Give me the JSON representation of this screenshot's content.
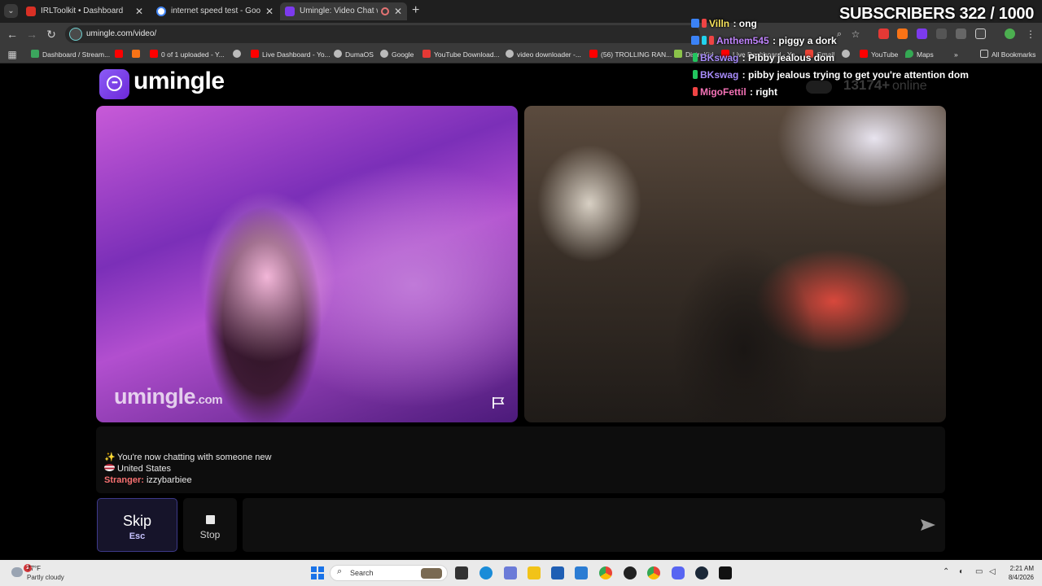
{
  "browser": {
    "tabs": [
      {
        "label": "IRLToolkit • Dashboard",
        "icon": "irltoolkit-icon",
        "color": "#d93025",
        "active": false
      },
      {
        "label": "internet speed test - Google Se",
        "icon": "google-icon",
        "color": "#4285f4",
        "active": false
      },
      {
        "label": "Umingle: Video Chat with S",
        "icon": "umingle-icon",
        "color": "#7c3aed",
        "active": true
      }
    ],
    "address": "umingle.com/video/",
    "bookmarks": [
      {
        "label": "Dashboard / Stream...",
        "icon": "streamelements-icon",
        "color": "#3ba55d"
      },
      {
        "label": "",
        "icon": "youtube-icon",
        "color": "#ff0000"
      },
      {
        "label": "",
        "icon": "folder-icon",
        "color": "#f97316"
      },
      {
        "label": "0 of 1 uploaded - Y...",
        "icon": "youtube-icon",
        "color": "#ff0000"
      },
      {
        "label": "",
        "icon": "globe-icon",
        "color": "#bbbbbb"
      },
      {
        "label": "Live Dashboard - Yo...",
        "icon": "youtube-icon",
        "color": "#ff0000"
      },
      {
        "label": "DumaOS",
        "icon": "globe-icon",
        "color": "#bbbbbb"
      },
      {
        "label": "Google",
        "icon": "google-icon",
        "color": "#bbbbbb"
      },
      {
        "label": "YouTube Download...",
        "icon": "download-icon",
        "color": "#e53935"
      },
      {
        "label": "video downloader -...",
        "icon": "google-icon",
        "color": "#bbbbbb"
      },
      {
        "label": "(56) TROLLING RAN...",
        "icon": "youtube-icon",
        "color": "#ff0000"
      },
      {
        "label": "DistroKid",
        "icon": "distrokid-icon",
        "color": "#8bc34a"
      },
      {
        "label": "Live Dashboard - Yo...",
        "icon": "youtube-icon",
        "color": "#ff0000"
      },
      {
        "label": "Gmail",
        "icon": "gmail-icon",
        "color": "#ea4335"
      },
      {
        "label": "",
        "icon": "globe-icon",
        "color": "#bbbbbb"
      },
      {
        "label": "YouTube",
        "icon": "youtube-icon",
        "color": "#ff0000"
      },
      {
        "label": "Maps",
        "icon": "maps-icon",
        "color": "#34a853"
      }
    ],
    "all_bookmarks": "All Bookmarks"
  },
  "site": {
    "logo_text": "umingle",
    "online_count": "13174+",
    "online_label": "online",
    "watermark_main": "umingle",
    "watermark_suffix": ".com",
    "chat": {
      "line1": "You're now chatting with someone new",
      "line2": "United States",
      "stranger_label": "Stranger:",
      "stranger_name": "izzybarbiee"
    },
    "skip_label": "Skip",
    "skip_key": "Esc",
    "stop_label": "Stop",
    "input_placeholder": ""
  },
  "overlay": {
    "subscribers": "SUBSCRIBERS 322 / 1000",
    "messages": [
      {
        "user": "Villn",
        "text": "ong",
        "user_color": "#f8e45c"
      },
      {
        "user": "Anthem545",
        "text": "piggy a dork",
        "user_color": "#c084fc"
      },
      {
        "user": "BKswag",
        "text": "Pibby jealous dom",
        "user_color": "#a78bfa"
      },
      {
        "user": "BKswag",
        "text": "pibby jealous trying to get you're attention dom",
        "user_color": "#a78bfa"
      },
      {
        "user": "MigoFettil",
        "text": "right",
        "user_color": "#f472b6"
      }
    ]
  },
  "taskbar": {
    "weather_temp": "77°F",
    "weather_desc": "Partly cloudy",
    "weather_badge": "1",
    "search_label": "Search",
    "time": "2:21 AM",
    "date": "8/4/2026"
  },
  "colors": {
    "accent": "#7c3aed",
    "skip_border": "#3d3a8a",
    "stranger_label": "#f87171"
  }
}
